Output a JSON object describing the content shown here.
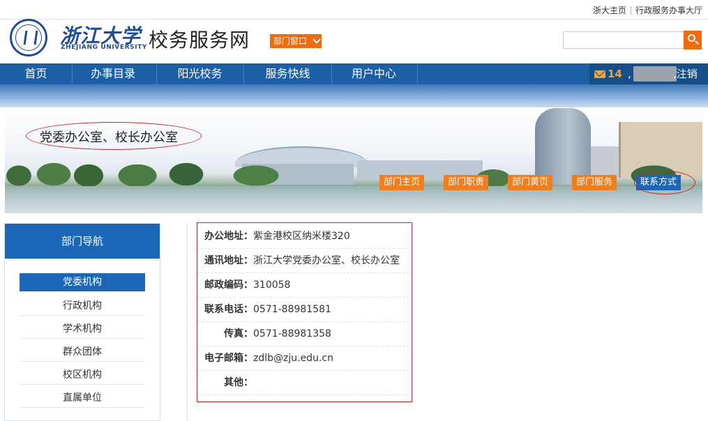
{
  "top_links": {
    "zju_home": "浙大主页",
    "admin_hall": "行政服务办事大厅"
  },
  "logo": {
    "cn": "浙江大学",
    "en": "ZHEJIANG UNIVERSITY"
  },
  "site_title": "校务服务网",
  "dept_window_button": "部门窗口",
  "search": {
    "value": "",
    "placeholder": ""
  },
  "nav": {
    "items": [
      {
        "label": "首页"
      },
      {
        "label": "办事目录"
      },
      {
        "label": "阳光校务"
      },
      {
        "label": "服务快线"
      },
      {
        "label": "用户中心"
      }
    ],
    "user": {
      "mail_count": "14",
      "comma": ",",
      "logout": ",注销"
    }
  },
  "banner": {
    "dept_name": "党委办公室、校长办公室",
    "tabs": [
      {
        "label": "部门主页",
        "active": false
      },
      {
        "label": "部门职责",
        "active": false
      },
      {
        "label": "部门黄页",
        "active": false
      },
      {
        "label": "部门服务",
        "active": false
      },
      {
        "label": "联系方式",
        "active": true
      }
    ]
  },
  "sidebar": {
    "title": "部门导航",
    "items": [
      {
        "label": "党委机构",
        "active": true
      },
      {
        "label": "行政机构",
        "active": false
      },
      {
        "label": "学术机构",
        "active": false
      },
      {
        "label": "群众团体",
        "active": false
      },
      {
        "label": "校区机构",
        "active": false
      },
      {
        "label": "直属单位",
        "active": false
      }
    ]
  },
  "contact": {
    "rows": [
      {
        "label": "办公地址：",
        "value": "紫金港校区纳米楼320"
      },
      {
        "label": "通讯地址：",
        "value": "浙江大学党委办公室、校长办公室"
      },
      {
        "label": "邮政编码：",
        "value": "310058"
      },
      {
        "label": "联系电话：",
        "value": "0571-88981581"
      },
      {
        "label": "传真：",
        "value": "0571-88981358"
      },
      {
        "label": "电子邮箱：",
        "value": "zdlb@zju.edu.cn"
      },
      {
        "label": "其他：",
        "value": ""
      }
    ]
  },
  "colors": {
    "brand_blue": "#1b66b6",
    "accent_orange": "#f07e1e",
    "annotation_red": "#c8262b"
  }
}
